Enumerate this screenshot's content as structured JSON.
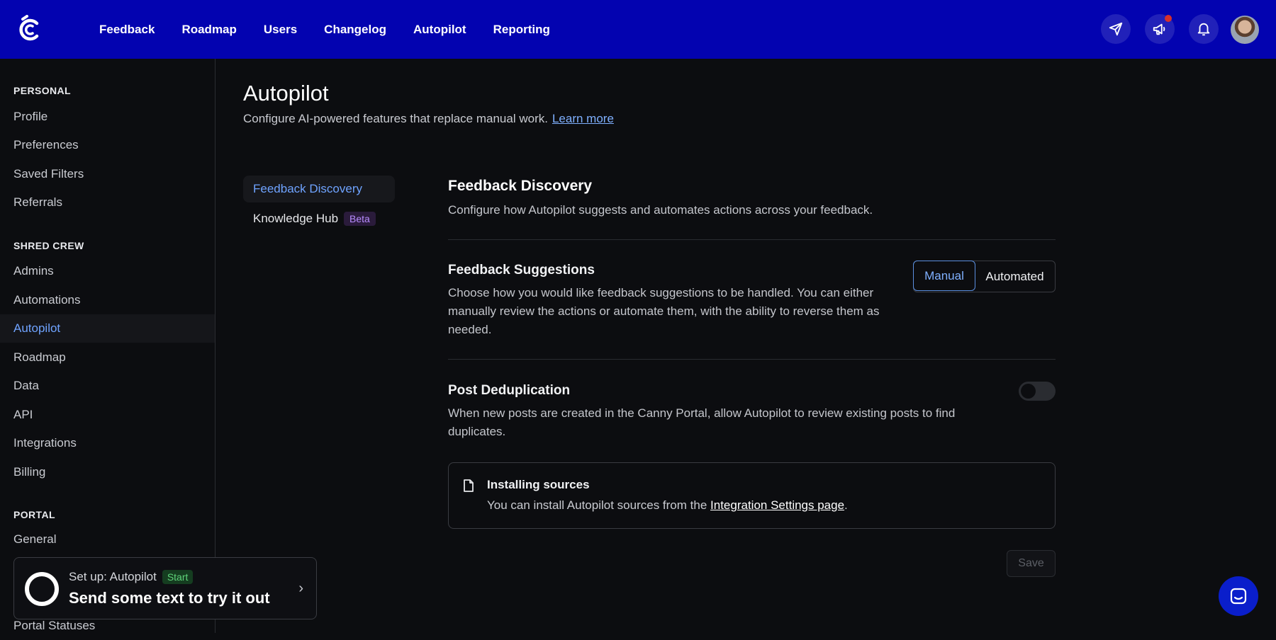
{
  "header": {
    "nav": [
      "Feedback",
      "Roadmap",
      "Users",
      "Changelog",
      "Autopilot",
      "Reporting"
    ],
    "icons": [
      "send-icon",
      "megaphone-icon",
      "bell-icon",
      "avatar"
    ],
    "colors": {
      "bar": "#0303b0",
      "notif_dot": "#d6302b"
    }
  },
  "sidebar": {
    "personal_title": "PERSONAL",
    "personal_items": [
      "Profile",
      "Preferences",
      "Saved Filters",
      "Referrals"
    ],
    "team_title": "SHRED CREW",
    "team_items": [
      "Admins",
      "Automations",
      "Autopilot",
      "Roadmap",
      "Data",
      "API",
      "Integrations",
      "Billing"
    ],
    "active_item": "Autopilot",
    "portal_title": "PORTAL",
    "portal_items": [
      "General",
      "Portal Statuses"
    ]
  },
  "setup": {
    "label": "Set up: Autopilot",
    "badge": "Start",
    "main": "Send some text to try it out"
  },
  "page": {
    "title": "Autopilot",
    "subtitle": "Configure AI-powered features that replace manual work.",
    "learn_more": "Learn more"
  },
  "subnav": {
    "items": [
      "Feedback Discovery",
      "Knowledge Hub"
    ],
    "beta": "Beta"
  },
  "section": {
    "title": "Feedback Discovery",
    "desc": "Configure how Autopilot suggests and automates actions across your feedback."
  },
  "suggestions": {
    "title": "Feedback Suggestions",
    "desc": "Choose how you would like feedback suggestions to be handled. You can either manually review the actions or automate them, with the ability to reverse them as needed.",
    "options": [
      "Manual",
      "Automated"
    ],
    "selected": "Manual"
  },
  "dedup": {
    "title": "Post Deduplication",
    "desc": "When new posts are created in the Canny Portal, allow Autopilot to review existing posts to find duplicates.",
    "enabled": false
  },
  "info": {
    "title": "Installing sources",
    "text": "You can install Autopilot sources from the",
    "link": "Integration Settings page",
    "end": "."
  },
  "save_label": "Save"
}
